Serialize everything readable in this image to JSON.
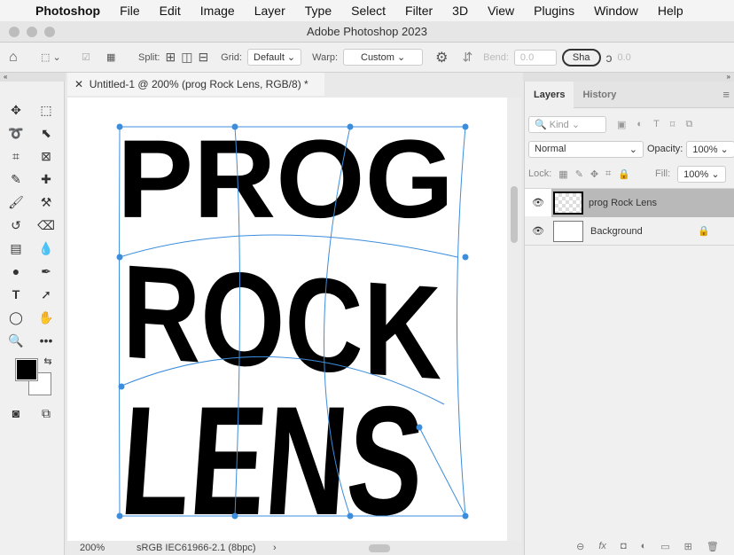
{
  "menubar": {
    "app": "Photoshop",
    "items": [
      "File",
      "Edit",
      "Image",
      "Layer",
      "Type",
      "Select",
      "Filter",
      "3D",
      "View",
      "Plugins",
      "Window",
      "Help"
    ]
  },
  "window": {
    "title": "Adobe Photoshop 2023"
  },
  "options": {
    "split_label": "Split:",
    "grid_label": "Grid:",
    "grid_value": "Default",
    "warp_label": "Warp:",
    "warp_value": "Custom",
    "bend_label": "Bend:",
    "bend_value": "0.0",
    "shape_value": "Sha",
    "v1": "0.0",
    "v2": "0.0"
  },
  "document": {
    "tab_title": "Untitled-1 @ 200% (prog Rock Lens, RGB/8) *",
    "lines": [
      "PROG",
      "ROCK",
      "LENS"
    ]
  },
  "status": {
    "zoom": "200%",
    "profile": "sRGB IEC61966-2.1 (8bpc)"
  },
  "panel": {
    "tabs": [
      "Layers",
      "History"
    ],
    "filter_kind": "Kind",
    "blend_mode": "Normal",
    "opacity_label": "Opacity:",
    "opacity": "100%",
    "lock_label": "Lock:",
    "fill_label": "Fill:",
    "fill": "100%",
    "layers": [
      {
        "name": "prog Rock Lens",
        "selected": true
      },
      {
        "name": "Background",
        "locked": true
      }
    ]
  },
  "colors": {
    "accent": "#3c8ddc",
    "selected_layer": "#b9b9b9"
  }
}
